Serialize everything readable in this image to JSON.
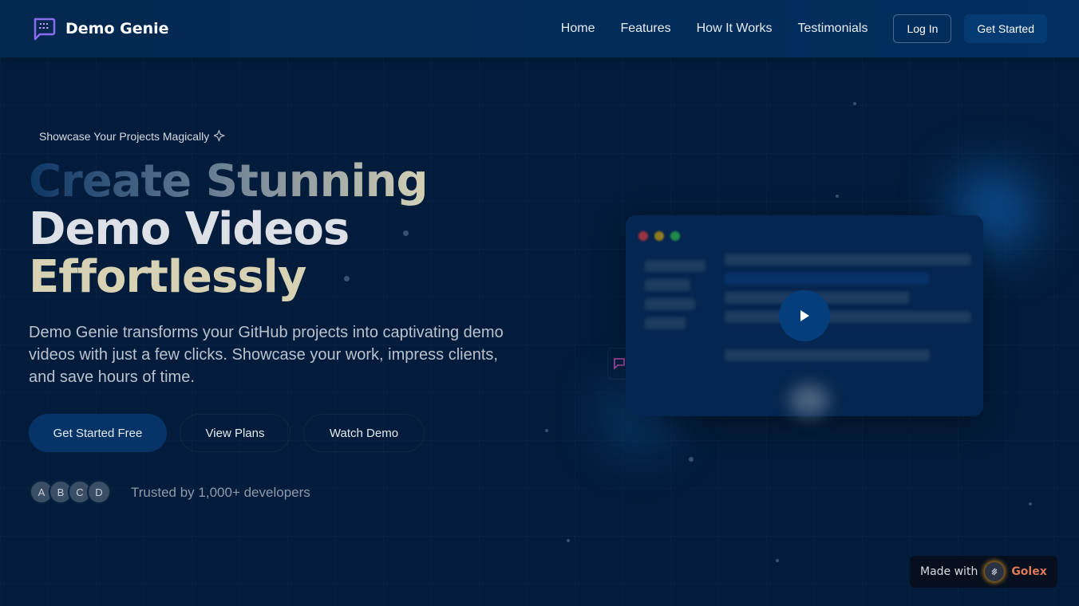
{
  "header": {
    "brand": "Demo Genie",
    "nav": [
      "Home",
      "Features",
      "How It Works",
      "Testimonials"
    ],
    "login": "Log In",
    "get_started": "Get Started"
  },
  "hero": {
    "badge": "Showcase Your Projects Magically",
    "title_line1": "Create Stunning",
    "title_line2": "Demo Videos",
    "title_line3": "Effortlessly",
    "description": "Demo Genie transforms your GitHub projects into captivating demo videos with just a few clicks. Showcase your work, impress clients, and save hours of time.",
    "buttons": [
      "Get Started Free",
      "View Plans",
      "Watch Demo"
    ],
    "avatars": [
      "A",
      "B",
      "C",
      "D"
    ],
    "trust": "Trusted by 1,000+ developers"
  },
  "footer_badge": {
    "prefix": "Made with",
    "brand": "Golex"
  },
  "colors": {
    "background": "#031c3b",
    "header": "#03284f",
    "accent": "#053a73",
    "brand_logo": "#8b6cf0",
    "golex": "#e0785a"
  }
}
